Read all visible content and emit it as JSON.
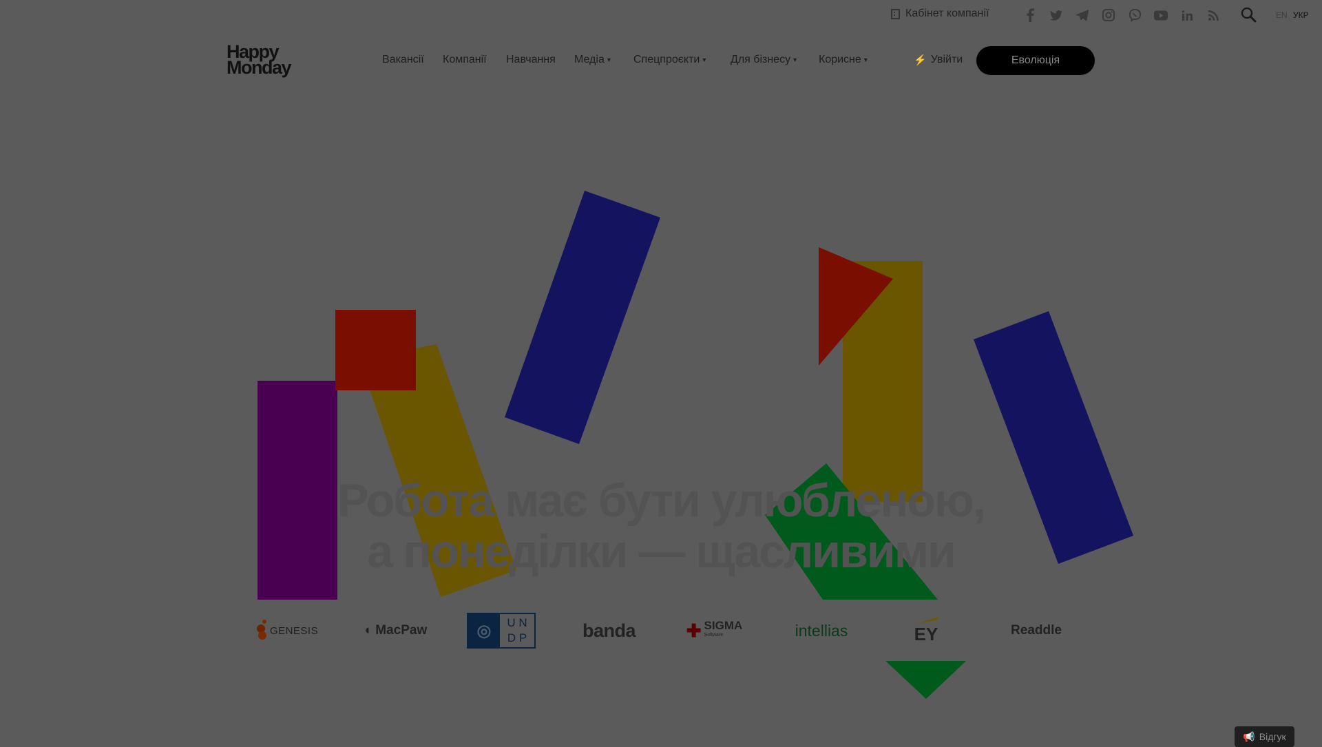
{
  "topbar": {
    "cabinet_label": "Кабінет компанії",
    "socials": [
      "facebook-icon",
      "twitter-icon",
      "telegram-icon",
      "instagram-icon",
      "viber-icon",
      "youtube-icon",
      "linkedin-icon",
      "rss-icon"
    ],
    "lang_en": "EN",
    "lang_ukr": "УКР"
  },
  "header": {
    "logo_line1": "Happy",
    "logo_line2": "Monday",
    "nav": {
      "vacancies": "Вакансії",
      "companies": "Компанії",
      "education": "Навчання",
      "media": "Медіа",
      "special": "Спецпроєкти",
      "business": "Для бізнесу",
      "useful": "Корисне"
    },
    "login_label": "Увійти",
    "evolution_label": "Еволюція"
  },
  "hero": {
    "headline_line1": "Робота має бути улюбленою,",
    "headline_line2": "а понеділки — щасливими"
  },
  "partners": {
    "genesis": "GENESIS",
    "macpaw": "MacPaw",
    "undp_top": "U N",
    "undp_bottom": "D P",
    "banda": "banda",
    "sigma": "SIGMA",
    "sigma_sub": "Software",
    "intellias": "intellias",
    "ey": "EY",
    "readdle": "Readdle"
  },
  "feedback_label": "Відгук",
  "colors": {
    "overlay_bg": "#5b5b5b",
    "purple": "#4a0050",
    "red": "#7a0e00",
    "mustard": "#6a5500",
    "navy": "#141360",
    "green": "#005a1c",
    "button_bg": "#000000"
  }
}
